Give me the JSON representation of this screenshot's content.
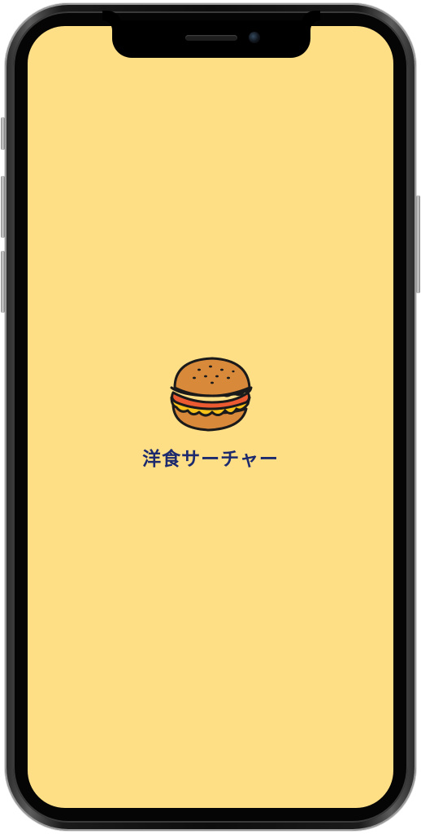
{
  "app": {
    "name": "洋食サーチャー",
    "logo_icon": "hamburger-icon"
  },
  "colors": {
    "screen_background": "#ffdf85",
    "title_text": "#1d2b6e"
  }
}
